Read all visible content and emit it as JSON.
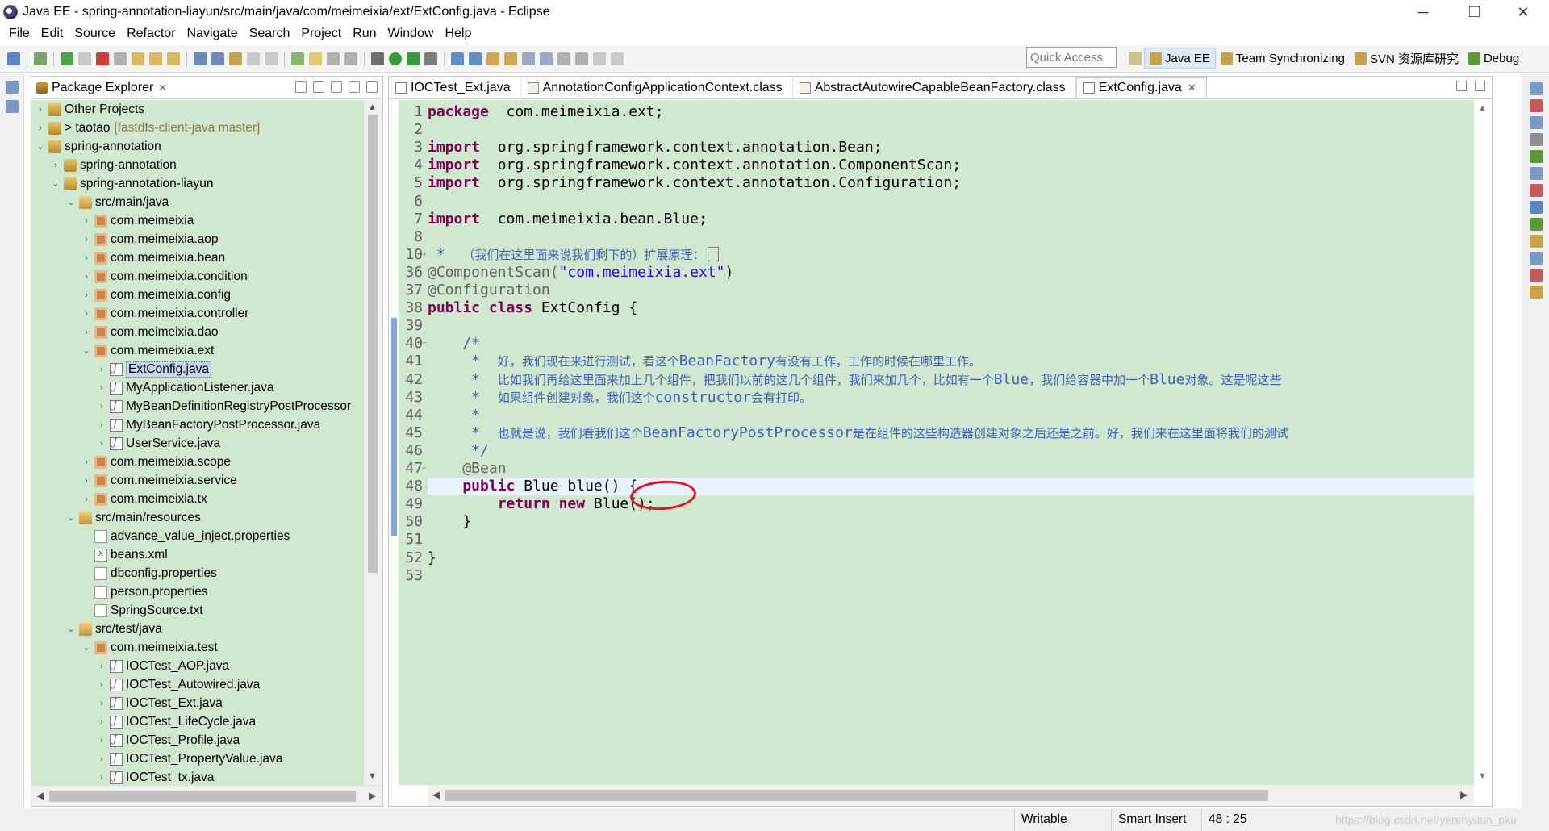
{
  "window": {
    "title": "Java EE - spring-annotation-liayun/src/main/java/com/meimeixia/ext/ExtConfig.java - Eclipse",
    "minimize": "─",
    "restore": "❐",
    "close": "✕"
  },
  "menu": [
    "File",
    "Edit",
    "Source",
    "Refactor",
    "Navigate",
    "Search",
    "Project",
    "Run",
    "Window",
    "Help"
  ],
  "toolbar": {
    "quick_access_placeholder": "Quick Access",
    "perspectives": [
      {
        "label": "Java EE",
        "active": true,
        "color": "#c9a14a"
      },
      {
        "label": "Team Synchronizing",
        "active": false,
        "color": "#c9a14a"
      },
      {
        "label": "SVN 资源库研究",
        "active": false,
        "color": "#c9a14a"
      },
      {
        "label": "Debug",
        "active": false,
        "color": "#5a9a3a"
      }
    ]
  },
  "package_explorer": {
    "title": "Package Explorer",
    "close": "✕",
    "tree": [
      {
        "depth": 0,
        "twist": "›",
        "icon": "proj",
        "label": "Other Projects"
      },
      {
        "depth": 0,
        "twist": "›",
        "icon": "proj",
        "label": "> taotao",
        "dec": "[fastdfs-client-java master]"
      },
      {
        "depth": 0,
        "twist": "⌄",
        "icon": "proj",
        "label": "spring-annotation"
      },
      {
        "depth": 1,
        "twist": "›",
        "icon": "proj",
        "label": "spring-annotation"
      },
      {
        "depth": 1,
        "twist": "⌄",
        "icon": "proj",
        "label": "spring-annotation-liayun"
      },
      {
        "depth": 2,
        "twist": "⌄",
        "icon": "srcf",
        "label": "src/main/java"
      },
      {
        "depth": 3,
        "twist": "›",
        "icon": "pkg",
        "label": "com.meimeixia"
      },
      {
        "depth": 3,
        "twist": "›",
        "icon": "pkg",
        "label": "com.meimeixia.aop"
      },
      {
        "depth": 3,
        "twist": "›",
        "icon": "pkg",
        "label": "com.meimeixia.bean"
      },
      {
        "depth": 3,
        "twist": "›",
        "icon": "pkg",
        "label": "com.meimeixia.condition"
      },
      {
        "depth": 3,
        "twist": "›",
        "icon": "pkg",
        "label": "com.meimeixia.config"
      },
      {
        "depth": 3,
        "twist": "›",
        "icon": "pkg",
        "label": "com.meimeixia.controller"
      },
      {
        "depth": 3,
        "twist": "›",
        "icon": "pkg",
        "label": "com.meimeixia.dao"
      },
      {
        "depth": 3,
        "twist": "⌄",
        "icon": "pkg",
        "label": "com.meimeixia.ext"
      },
      {
        "depth": 4,
        "twist": "›",
        "icon": "jfile",
        "label": "ExtConfig.java",
        "selected": true
      },
      {
        "depth": 4,
        "twist": "›",
        "icon": "jfile",
        "label": "MyApplicationListener.java"
      },
      {
        "depth": 4,
        "twist": "›",
        "icon": "jfile",
        "label": "MyBeanDefinitionRegistryPostProcessor"
      },
      {
        "depth": 4,
        "twist": "›",
        "icon": "jfile",
        "label": "MyBeanFactoryPostProcessor.java"
      },
      {
        "depth": 4,
        "twist": "›",
        "icon": "jfile",
        "label": "UserService.java"
      },
      {
        "depth": 3,
        "twist": "›",
        "icon": "pkg",
        "label": "com.meimeixia.scope"
      },
      {
        "depth": 3,
        "twist": "›",
        "icon": "pkg",
        "label": "com.meimeixia.service"
      },
      {
        "depth": 3,
        "twist": "›",
        "icon": "pkg",
        "label": "com.meimeixia.tx"
      },
      {
        "depth": 2,
        "twist": "⌄",
        "icon": "srcf",
        "label": "src/main/resources"
      },
      {
        "depth": 3,
        "twist": "",
        "icon": "txt",
        "label": "advance_value_inject.properties"
      },
      {
        "depth": 3,
        "twist": "",
        "icon": "xml",
        "label": "beans.xml"
      },
      {
        "depth": 3,
        "twist": "",
        "icon": "txt",
        "label": "dbconfig.properties"
      },
      {
        "depth": 3,
        "twist": "",
        "icon": "txt",
        "label": "person.properties"
      },
      {
        "depth": 3,
        "twist": "",
        "icon": "txt",
        "label": "SpringSource.txt"
      },
      {
        "depth": 2,
        "twist": "⌄",
        "icon": "srcf",
        "label": "src/test/java"
      },
      {
        "depth": 3,
        "twist": "⌄",
        "icon": "pkg",
        "label": "com.meimeixia.test"
      },
      {
        "depth": 4,
        "twist": "›",
        "icon": "jfile",
        "label": "IOCTest_AOP.java"
      },
      {
        "depth": 4,
        "twist": "›",
        "icon": "jfile",
        "label": "IOCTest_Autowired.java"
      },
      {
        "depth": 4,
        "twist": "›",
        "icon": "jfile",
        "label": "IOCTest_Ext.java"
      },
      {
        "depth": 4,
        "twist": "›",
        "icon": "jfile",
        "label": "IOCTest_LifeCycle.java"
      },
      {
        "depth": 4,
        "twist": "›",
        "icon": "jfile",
        "label": "IOCTest_Profile.java"
      },
      {
        "depth": 4,
        "twist": "›",
        "icon": "jfile",
        "label": "IOCTest_PropertyValue.java"
      },
      {
        "depth": 4,
        "twist": "›",
        "icon": "jfile",
        "label": "IOCTest_tx.java"
      }
    ]
  },
  "editor": {
    "tabs": [
      {
        "label": "IOCTest_Ext.java",
        "kind": "java",
        "active": false
      },
      {
        "label": "AnnotationConfigApplicationContext.class",
        "kind": "class",
        "active": false
      },
      {
        "label": "AbstractAutowireCapableBeanFactory.class",
        "kind": "class",
        "active": false
      },
      {
        "label": "ExtConfig.java",
        "kind": "java",
        "active": true,
        "close": "✕"
      }
    ],
    "lines": [
      {
        "n": "1",
        "t": [
          [
            "kw",
            "package"
          ],
          [
            "",
            "  com.meimeixia.ext;"
          ]
        ]
      },
      {
        "n": "2",
        "t": []
      },
      {
        "n": "3",
        "t": [
          [
            "kw",
            "import"
          ],
          [
            "",
            "  org.springframework.context.annotation.Bean;"
          ]
        ]
      },
      {
        "n": "4",
        "t": [
          [
            "kw",
            "import"
          ],
          [
            "",
            "  org.springframework.context.annotation.ComponentScan;"
          ]
        ]
      },
      {
        "n": "5",
        "t": [
          [
            "kw",
            "import"
          ],
          [
            "",
            "  org.springframework.context.annotation.Configuration;"
          ]
        ]
      },
      {
        "n": "6",
        "t": []
      },
      {
        "n": "7",
        "t": [
          [
            "kw",
            "import"
          ],
          [
            "",
            "  com.meimeixia.bean.Blue;"
          ]
        ]
      },
      {
        "n": "8",
        "t": []
      },
      {
        "n": "10",
        "fold": "+",
        "t": [
          [
            "cmt",
            " *  "
          ],
          [
            "cmt-cn",
            "（我们在这里面来说我们剩下的）扩展原理："
          ],
          [
            "box",
            ""
          ]
        ]
      },
      {
        "n": "36",
        "t": [
          [
            "ann",
            "@ComponentScan("
          ],
          [
            "str",
            "\"com.meimeixia.ext\""
          ],
          [
            "",
            ")"
          ]
        ]
      },
      {
        "n": "37",
        "t": [
          [
            "ann",
            "@Configuration"
          ]
        ]
      },
      {
        "n": "38",
        "t": [
          [
            "kw",
            "public"
          ],
          [
            "",
            " "
          ],
          [
            "kw",
            "class"
          ],
          [
            "",
            " ExtConfig {"
          ]
        ]
      },
      {
        "n": "39",
        "t": []
      },
      {
        "n": "40",
        "fold": "−",
        "t": [
          [
            "cmt",
            "    /*"
          ]
        ]
      },
      {
        "n": "41",
        "t": [
          [
            "cmt",
            "     *  "
          ],
          [
            "cmt-cn",
            "好，我们现在来进行测试，看这个"
          ],
          [
            "cmt",
            "BeanFactory"
          ],
          [
            "cmt-cn",
            "有没有工作，工作的时候在哪里工作。"
          ]
        ]
      },
      {
        "n": "42",
        "t": [
          [
            "cmt",
            "     *  "
          ],
          [
            "cmt-cn",
            "比如我们再给这里面来加上几个组件，把我们以前的这几个组件，我们来加几个，比如有一个"
          ],
          [
            "cmt",
            "Blue"
          ],
          [
            "cmt-cn",
            "，我们给容器中加一个"
          ],
          [
            "cmt",
            "Blue"
          ],
          [
            "cmt-cn",
            "对象。这是呢这些"
          ]
        ]
      },
      {
        "n": "43",
        "t": [
          [
            "cmt",
            "     *  "
          ],
          [
            "cmt-cn",
            "如果组件创建对象，我们这个"
          ],
          [
            "cmt",
            "constructor"
          ],
          [
            "cmt-cn",
            "会有打印。"
          ]
        ]
      },
      {
        "n": "44",
        "t": [
          [
            "cmt",
            "     *"
          ]
        ]
      },
      {
        "n": "45",
        "t": [
          [
            "cmt",
            "     *  "
          ],
          [
            "cmt-cn",
            "也就是说，我们看我们这个"
          ],
          [
            "cmt",
            "BeanFactoryPostProcessor"
          ],
          [
            "cmt-cn",
            "是在组件的这些构造器创建对象之后还是之前。好，我们来在这里面将我们的测试"
          ]
        ]
      },
      {
        "n": "46",
        "t": [
          [
            "cmt",
            "     */"
          ]
        ]
      },
      {
        "n": "47",
        "fold": "−",
        "t": [
          [
            "ann",
            "    @Bean"
          ]
        ]
      },
      {
        "n": "48",
        "current": true,
        "t": [
          [
            "kw",
            "    public"
          ],
          [
            "",
            " Blue blue() {"
          ]
        ]
      },
      {
        "n": "49",
        "t": [
          [
            "kw",
            "        return"
          ],
          [
            "",
            " "
          ],
          [
            "kw",
            "new"
          ],
          [
            "",
            " Blue();"
          ]
        ]
      },
      {
        "n": "50",
        "t": [
          [
            "",
            "    }"
          ]
        ]
      },
      {
        "n": "51",
        "t": []
      },
      {
        "n": "52",
        "t": [
          [
            "",
            "}"
          ]
        ]
      },
      {
        "n": "53",
        "t": []
      }
    ]
  },
  "status": {
    "writable": "Writable",
    "insert_mode": "Smart Insert",
    "position": "48 : 25",
    "watermark": "https://blog.csdn.net/yerenyuan_pku"
  }
}
